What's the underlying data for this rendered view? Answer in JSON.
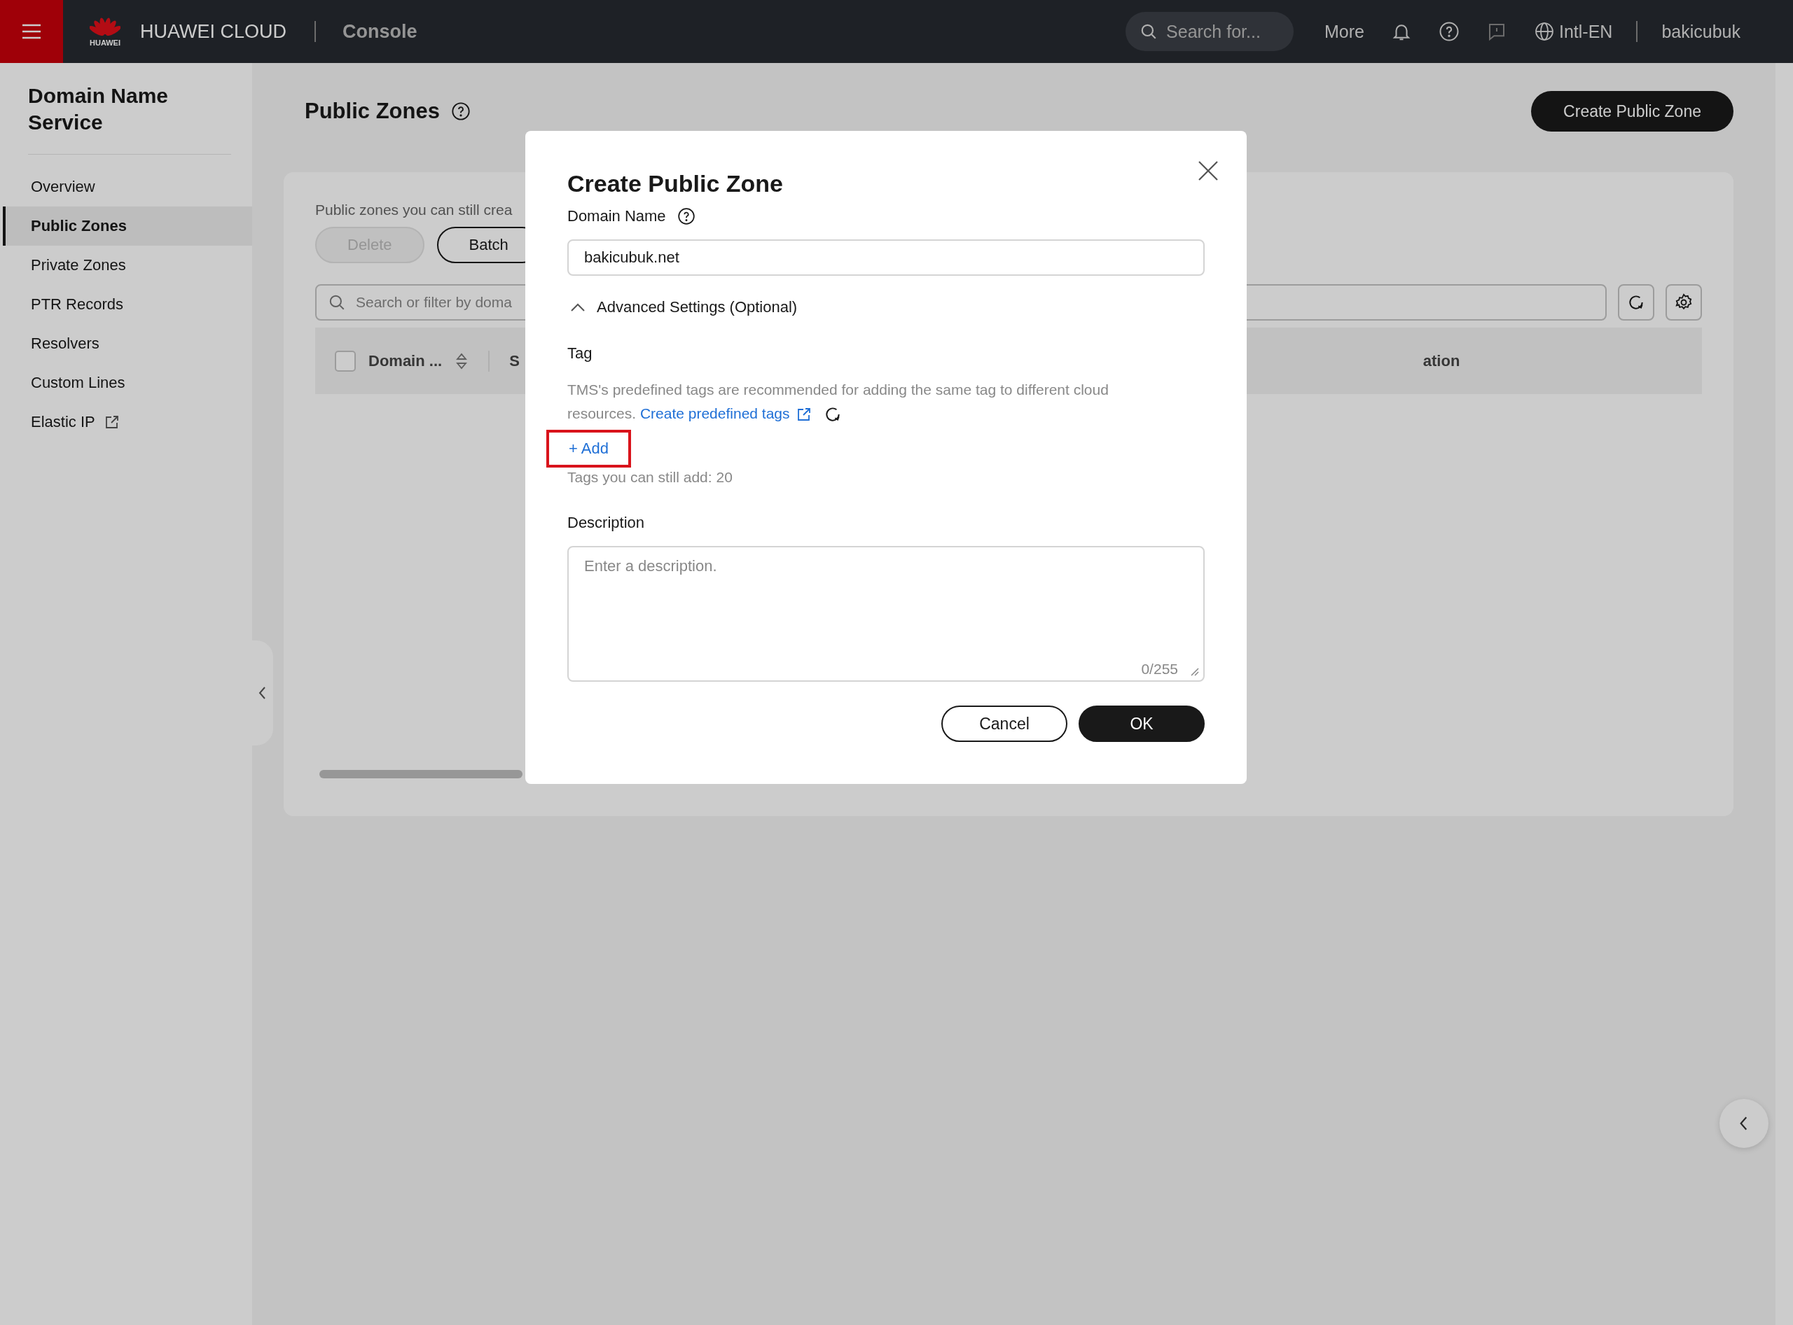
{
  "top_bar": {
    "logo_caption": "HUAWEI",
    "brand": "HUAWEI CLOUD",
    "console": "Console",
    "search": {
      "placeholder": "Search for..."
    },
    "more": "More",
    "language": "Intl-EN",
    "user": "bakicubuk"
  },
  "sidebar": {
    "title": "Domain Name Service",
    "items": [
      {
        "label": "Overview",
        "selected": false,
        "external": false
      },
      {
        "label": "Public Zones",
        "selected": true,
        "external": false
      },
      {
        "label": "Private Zones",
        "selected": false,
        "external": false
      },
      {
        "label": "PTR Records",
        "selected": false,
        "external": false
      },
      {
        "label": "Resolvers",
        "selected": false,
        "external": false
      },
      {
        "label": "Custom Lines",
        "selected": false,
        "external": false
      },
      {
        "label": "Elastic IP",
        "selected": false,
        "external": true
      }
    ]
  },
  "page": {
    "title": "Public Zones",
    "create_button": "Create Public Zone",
    "quota_text": "Public zones you can still crea",
    "buttons": [
      {
        "label": "Delete",
        "disabled": true
      },
      {
        "label": "Batch",
        "disabled": false
      }
    ],
    "search": {
      "placeholder": "Search or filter by doma"
    },
    "table": {
      "select_all_checked": false,
      "columns": [
        {
          "label": "Domain ...",
          "sortable": true
        },
        {
          "label": "S",
          "sortable": false
        },
        {
          "label": "ation",
          "sortable": false
        }
      ]
    }
  },
  "dialog": {
    "title": "Create Public Zone",
    "domain_name": {
      "label": "Domain Name",
      "value": "bakicubuk.net"
    },
    "advanced": {
      "label": "Advanced Settings (Optional)",
      "expanded": true
    },
    "tag": {
      "label": "Tag",
      "hint": "TMS's predefined tags are recommended for adding the same tag to different cloud resources.",
      "link": "Create predefined tags",
      "add": "+ Add",
      "add_highlighted": true,
      "quota": "Tags you can still add: 20"
    },
    "description": {
      "label": "Description",
      "placeholder": "Enter a description.",
      "counter": "0/255"
    },
    "buttons": [
      {
        "label": "Cancel",
        "kind": "secondary"
      },
      {
        "label": "OK",
        "kind": "primary"
      }
    ]
  }
}
